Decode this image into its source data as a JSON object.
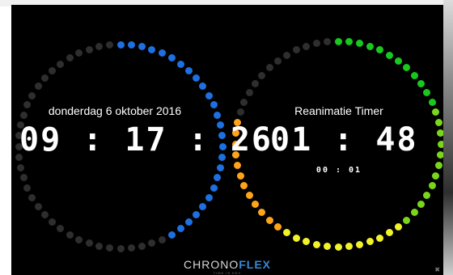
{
  "left_clock": {
    "date": "donderdag 6 oktober 2016",
    "time": "09 : 17 : 26",
    "progress": {
      "lit": 26,
      "total": 60
    },
    "lit_color": "#1e6fe0",
    "unlit_color": "#2e2e2e"
  },
  "right_clock": {
    "title": "Reanimatie Timer",
    "timer": "01 : 48",
    "sub_timer": "00 : 01",
    "progress": {
      "lit": 48,
      "total": 60
    },
    "segment_colors": [
      "#18c81e",
      "#7ad61a",
      "#f2f22a",
      "#ffa319",
      "#e01818"
    ],
    "unlit_color": "#2e2e2e"
  },
  "brand": {
    "name_part1": "CHRONO",
    "name_part2": "FLEX",
    "tagline": "TIME IS KEY"
  },
  "corner_mark": "✖"
}
